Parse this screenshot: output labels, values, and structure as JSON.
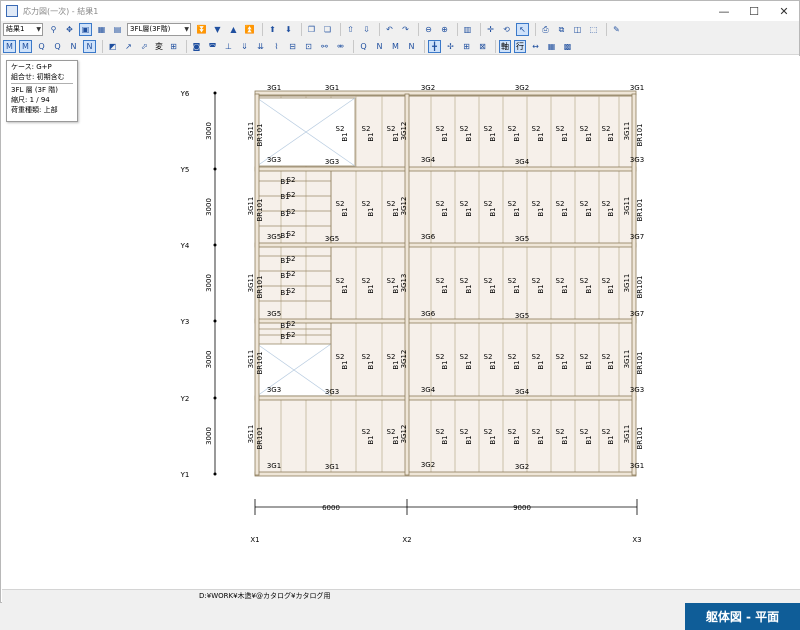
{
  "window": {
    "title": "応力図(一次) - 結果1",
    "controls": [
      "—",
      "☐",
      "✕"
    ]
  },
  "toolbar1": {
    "result_select": "結果1",
    "floor_select": "3FL層(3F階)"
  },
  "toolbar2": {
    "buttons": [
      "M",
      "M",
      "Q",
      "Q",
      "N",
      "N"
    ],
    "henkei_label": "変",
    "kata_label": "軸",
    "gyo_label": "行"
  },
  "info": {
    "case": "ケース: G+P",
    "combination": "組合せ: 初期含む",
    "layer": "3FL 層 (3F 階)",
    "scale": "縮尺: 1 / 94",
    "load": "荷重種類: 上部"
  },
  "plan": {
    "y_axes": [
      "Y1",
      "Y2",
      "Y3",
      "Y4",
      "Y5",
      "Y6"
    ],
    "x_axes": [
      "X1",
      "X2",
      "X3"
    ],
    "y_spans": [
      "3000",
      "3000",
      "3000",
      "3000",
      "3000"
    ],
    "x_spans": [
      "6000",
      "9000"
    ],
    "girders": {
      "top_left": "3G1",
      "top_mid1": "3G1",
      "top_x2": "3G2",
      "top_mid2": "3G2",
      "top_right": "3G1",
      "y5_left": "3G3",
      "y5_mid": "3G3",
      "y5_x2": "3G4",
      "y5_mid2": "3G4",
      "y5_right": "3G3",
      "y4_left": "3G5",
      "y4_mid": "3G5",
      "y4_x2": "3G6",
      "y4_mid2": "3G5",
      "y4_right": "3G7",
      "y3_left": "3G5",
      "y3_x2": "3G6",
      "y3_mid2": "3G5",
      "y3_right": "3G7",
      "y2_left": "3G3",
      "y2_mid": "3G3",
      "y2_x2": "3G4",
      "y2_mid2": "3G4",
      "y2_right": "3G3",
      "bot_left": "3G1",
      "bot_mid": "3G1",
      "bot_x2": "3G2",
      "bot_mid2": "3G2",
      "bot_right": "3G1"
    },
    "col_left": [
      "3G11",
      "3G11",
      "3G11",
      "3G11",
      "3G11"
    ],
    "col_x2": [
      "3G12",
      "3G12",
      "3G13",
      "3G12",
      "3G12"
    ],
    "col_right": [
      "3G11",
      "3G11",
      "3G11",
      "3G11",
      "3G11"
    ],
    "brace": "BR101",
    "slab": "S2",
    "beam": "B1"
  },
  "status": {
    "path": "D:¥WORK¥木造¥@カタログ¥カタログ用"
  },
  "badge": {
    "label": "躯体図 - 平面"
  }
}
